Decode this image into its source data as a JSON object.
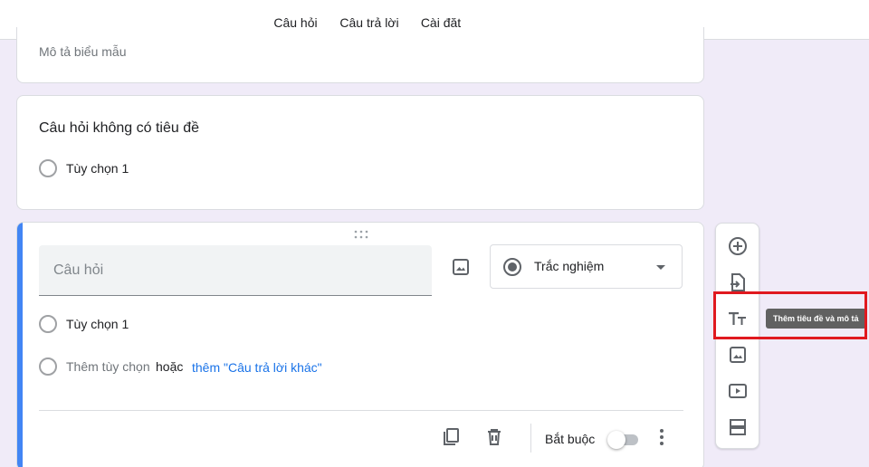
{
  "tabs": [
    {
      "label": "Câu hỏi",
      "active": true
    },
    {
      "label": "Câu trả lời",
      "active": false
    },
    {
      "label": "Cài đặt",
      "active": false
    }
  ],
  "form": {
    "description_placeholder": "Mô tả biểu mẫu"
  },
  "question1": {
    "title": "Câu hỏi không có tiêu đề",
    "option1": "Tùy chọn 1"
  },
  "question2": {
    "placeholder": "Câu hỏi",
    "type": "Trắc nghiệm",
    "option1": "Tùy chọn 1",
    "add_option": "Thêm tùy chọn",
    "or": "hoặc",
    "add_other": "thêm \"Câu trả lời khác\"",
    "required_label": "Bắt buộc",
    "required": false
  },
  "sidebar": {
    "tooltip": "Thêm tiêu đề và mô tả"
  },
  "colors": {
    "accent": "#673ab7",
    "active_card": "#4285f4",
    "link": "#1a73e8",
    "highlight": "#e0191f",
    "background": "#f0ebf8"
  }
}
